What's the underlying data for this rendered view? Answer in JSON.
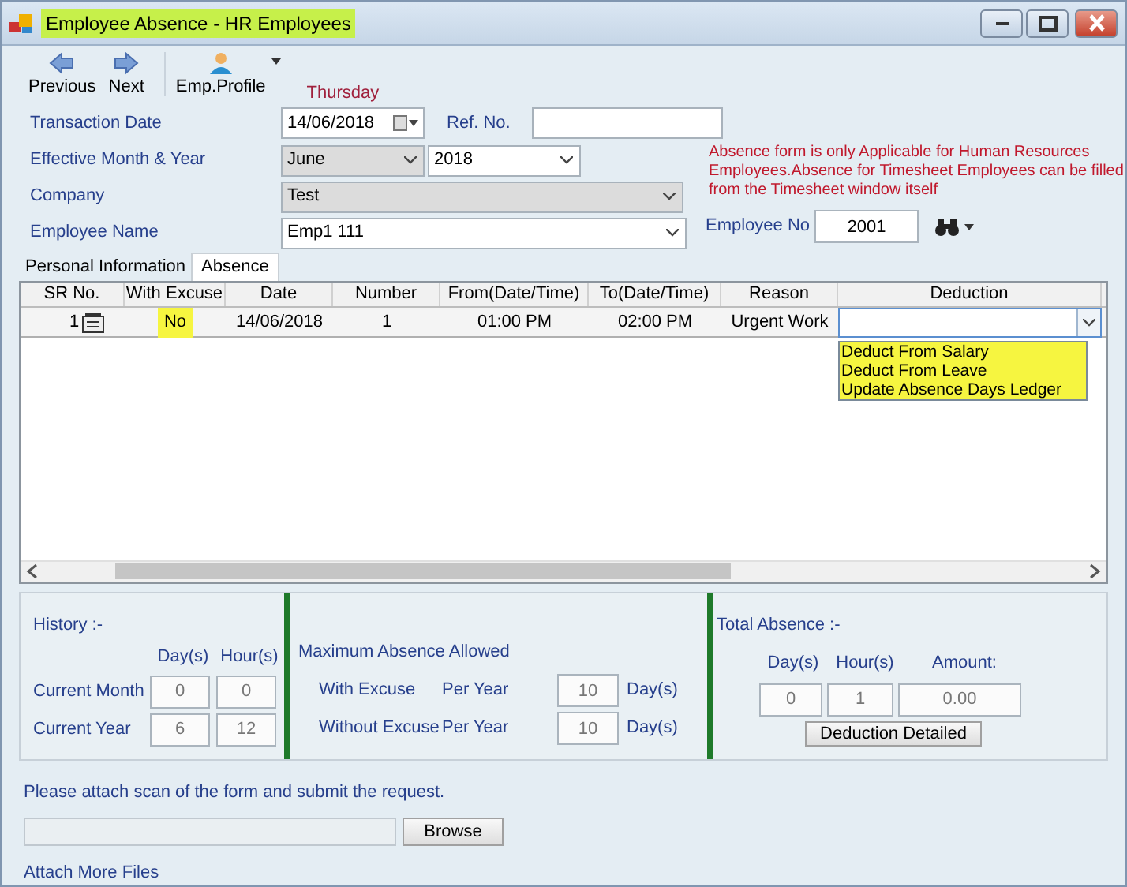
{
  "window": {
    "title": "Employee Absence - HR Employees",
    "highlighted": true
  },
  "toolbar": [
    {
      "label": "Previous",
      "kind": "prev"
    },
    {
      "label": "Next",
      "kind": "next"
    },
    {
      "label": "Emp.Profile",
      "kind": "profile"
    }
  ],
  "day_label": "Thursday",
  "transaction_date": {
    "label": "Transaction Date",
    "value": "14/06/2018"
  },
  "ref_no": {
    "label": "Ref. No."
  },
  "effective": {
    "label": "Effective Month & Year",
    "month": "June",
    "year": "2018"
  },
  "company": {
    "label": "Company",
    "value": "Test",
    "disabled": true
  },
  "employee_name": {
    "label": "Employee Name",
    "value": "Emp1 111"
  },
  "notice": "Absence form is only Applicable for Human Resources Employees.Absence for Timesheet Employees can be filled from the Timesheet window itself",
  "employee_no": {
    "label": "Employee No",
    "value": "2001"
  },
  "tabs": [
    {
      "label": "Personal Information",
      "selected": false
    },
    {
      "label": "Absence",
      "selected": true
    }
  ],
  "table": {
    "columns": [
      "SR No.",
      "With Excuse",
      "Date",
      "Number",
      "From(Date/Time)",
      "To(Date/Time)",
      "Reason",
      "Deduction"
    ],
    "rows": [
      {
        "cells": [
          {
            "text": "1",
            "highlighted": false
          },
          {
            "text": "No",
            "highlighted": true
          },
          {
            "text": "14/06/2018",
            "highlighted": false
          },
          {
            "text": "1",
            "highlighted": false
          },
          {
            "text": "01:00 PM",
            "highlighted": false
          },
          {
            "text": "02:00 PM",
            "highlighted": false
          },
          {
            "text": "Urgent Work",
            "highlighted": false
          }
        ]
      }
    ],
    "dropdown": {
      "highlighted": true,
      "options": [
        "Deduct From Salary",
        "Deduct From Leave",
        "Update Absence Days Ledger"
      ]
    }
  },
  "history": {
    "title": "History :-",
    "headers": [
      "Day(s)",
      "Hour(s)"
    ],
    "rows": [
      {
        "label": "Current Month",
        "values": [
          "0",
          "0"
        ]
      },
      {
        "label": "Current Year",
        "values": [
          "6",
          "12"
        ]
      }
    ]
  },
  "max_absence": {
    "title": "Maximum Absence Allowed",
    "rows": [
      {
        "label": "With Excuse",
        "period": "Per Year",
        "value": "10",
        "unit": "Day(s)"
      },
      {
        "label": "Without Excuse",
        "period": "Per Year",
        "value": "10",
        "unit": "Day(s)"
      }
    ]
  },
  "total_absence": {
    "title": "Total Absence :-",
    "headers": [
      "Day(s)",
      "Hour(s)",
      "Amount:"
    ],
    "values": [
      "0",
      "1",
      "0.00"
    ],
    "button": "Deduction Detailed"
  },
  "attach": {
    "instruction": "Please attach scan of the form and submit the request.",
    "button": "Browse",
    "more_link": "Attach More Files"
  }
}
